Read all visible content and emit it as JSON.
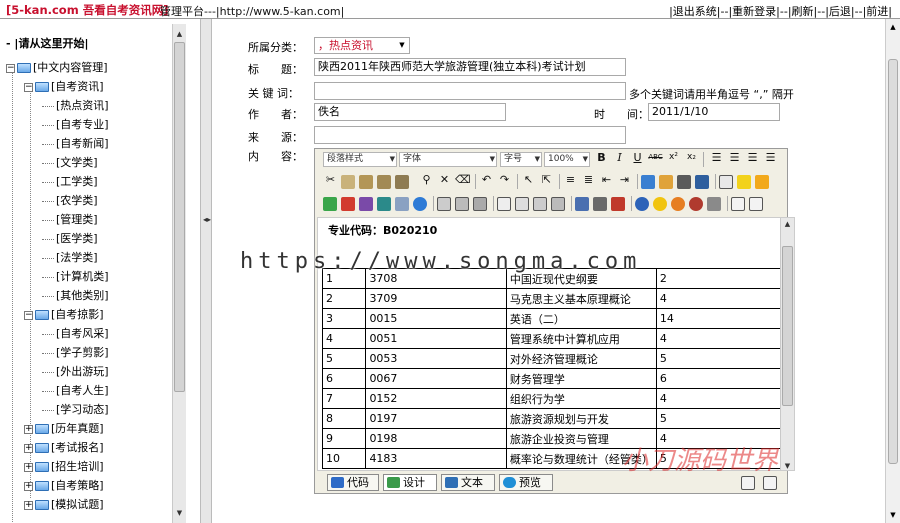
{
  "header": {
    "brand": "[5-kan.com 吾看自考资讯网]",
    "rest": "管理平台---|http://www.5-kan.com|",
    "menu": [
      "|退出系统|",
      "|重新登录|",
      "|刷新|",
      "|后退|",
      "|前进|"
    ],
    "menu_sep": "--"
  },
  "sidebar": {
    "heading": "|请从这里开始|",
    "items": [
      {
        "label": "[中文内容管理]",
        "level": 0,
        "type": "folder",
        "expanded": true
      },
      {
        "label": "[自考资讯]",
        "level": 1,
        "type": "folder",
        "expanded": true
      },
      {
        "label": "[热点资讯]",
        "level": 2,
        "type": "leaf"
      },
      {
        "label": "[自考专业]",
        "level": 2,
        "type": "leaf"
      },
      {
        "label": "[自考新闻]",
        "level": 2,
        "type": "leaf"
      },
      {
        "label": "[文学类]",
        "level": 2,
        "type": "leaf"
      },
      {
        "label": "[工学类]",
        "level": 2,
        "type": "leaf"
      },
      {
        "label": "[农学类]",
        "level": 2,
        "type": "leaf"
      },
      {
        "label": "[管理类]",
        "level": 2,
        "type": "leaf"
      },
      {
        "label": "[医学类]",
        "level": 2,
        "type": "leaf"
      },
      {
        "label": "[法学类]",
        "level": 2,
        "type": "leaf"
      },
      {
        "label": "[计算机类]",
        "level": 2,
        "type": "leaf"
      },
      {
        "label": "[其他类别]",
        "level": 2,
        "type": "leaf"
      },
      {
        "label": "[自考掠影]",
        "level": 1,
        "type": "folder",
        "expanded": true
      },
      {
        "label": "[自考风采]",
        "level": 2,
        "type": "leaf"
      },
      {
        "label": "[学子剪影]",
        "level": 2,
        "type": "leaf"
      },
      {
        "label": "[外出游玩]",
        "level": 2,
        "type": "leaf"
      },
      {
        "label": "[自考人生]",
        "level": 2,
        "type": "leaf"
      },
      {
        "label": "[学习动态]",
        "level": 2,
        "type": "leaf"
      },
      {
        "label": "[历年真题]",
        "level": 1,
        "type": "folder",
        "expanded": false
      },
      {
        "label": "[考试报名]",
        "level": 1,
        "type": "folder",
        "expanded": false
      },
      {
        "label": "[招生培训]",
        "level": 1,
        "type": "folder",
        "expanded": false
      },
      {
        "label": "[自考策略]",
        "level": 1,
        "type": "folder",
        "expanded": false
      },
      {
        "label": "[模拟试题]",
        "level": 1,
        "type": "folder",
        "expanded": false
      }
    ]
  },
  "form": {
    "category_label": "所属分类：",
    "category_value": "，热点资讯",
    "title_label": "标　　题：",
    "title_value": "陕西2011年陕西师范大学旅游管理(独立本科)考试计划",
    "keywords_label": "关 键 词：",
    "keywords_value": "",
    "keywords_hint": "多个关键词请用半角逗号 “,” 隔开",
    "author_label": "作　　者：",
    "author_value": "佚名",
    "time_label": "时　　间：",
    "time_value": "2011/1/10",
    "source_label": "来　　源：",
    "source_value": "",
    "content_label": "内　　容："
  },
  "editor": {
    "paragraph_style": "段落样式",
    "font": "字体",
    "font_size": "字号",
    "zoom": "100%",
    "doc_code": "专业代码：B020210",
    "courses": [
      [
        "1",
        "3708",
        "中国近现代史纲要",
        "2"
      ],
      [
        "2",
        "3709",
        "马克思主义基本原理概论",
        "4"
      ],
      [
        "3",
        "0015",
        "英语（二）",
        "14"
      ],
      [
        "4",
        "0051",
        "管理系统中计算机应用",
        "4"
      ],
      [
        "5",
        "0053",
        "对外经济管理概论",
        "5"
      ],
      [
        "6",
        "0067",
        "财务管理学",
        "6"
      ],
      [
        "7",
        "0152",
        "组织行为学",
        "4"
      ],
      [
        "8",
        "0197",
        "旅游资源规划与开发",
        "5"
      ],
      [
        "9",
        "0198",
        "旅游企业投资与管理",
        "4"
      ],
      [
        "10",
        "4183",
        "概率论与数理统计（经管类）",
        "5"
      ]
    ],
    "tabs": [
      "代码",
      "设计",
      "文本",
      "预览"
    ]
  },
  "watermarks": {
    "url": "https://www.songma.com",
    "red": "小刀源码世界"
  }
}
